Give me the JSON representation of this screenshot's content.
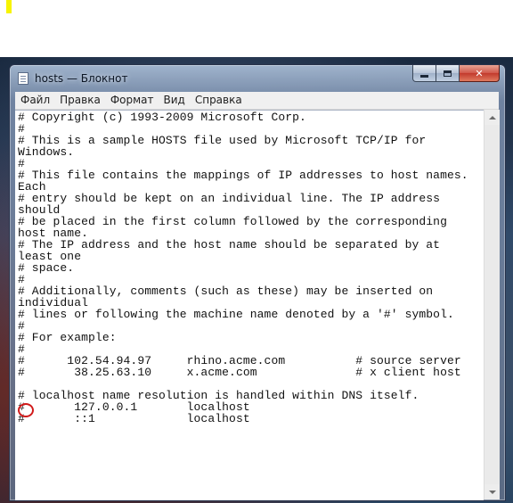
{
  "window": {
    "title": "hosts — Блокнот",
    "app_icon": "notepad-icon"
  },
  "caption_buttons": {
    "minimize_icon": "minimize-icon",
    "maximize_icon": "maximize-icon",
    "close_icon": "close-icon",
    "close_glyph": "✕"
  },
  "menu": {
    "items": [
      "Файл",
      "Правка",
      "Формат",
      "Вид",
      "Справка"
    ]
  },
  "editor": {
    "lines": [
      "# Copyright (c) 1993-2009 Microsoft Corp.",
      "#",
      "# This is a sample HOSTS file used by Microsoft TCP/IP for",
      "Windows.",
      "#",
      "# This file contains the mappings of IP addresses to host names.",
      "Each",
      "# entry should be kept on an individual line. The IP address",
      "should",
      "# be placed in the first column followed by the corresponding",
      "host name.",
      "# The IP address and the host name should be separated by at",
      "least one",
      "# space.",
      "#",
      "# Additionally, comments (such as these) may be inserted on",
      "individual",
      "# lines or following the machine name denoted by a '#' symbol.",
      "#",
      "# For example:",
      "#",
      "#      102.54.94.97     rhino.acme.com          # source server",
      "#       38.25.63.10     x.acme.com              # x client host",
      "",
      "# localhost name resolution is handled within DNS itself.",
      "#       127.0.0.1       localhost",
      "#       ::1             localhost"
    ]
  },
  "colors": {
    "annotation": "#d11a1a",
    "highlight_mark": "#f7f400"
  }
}
